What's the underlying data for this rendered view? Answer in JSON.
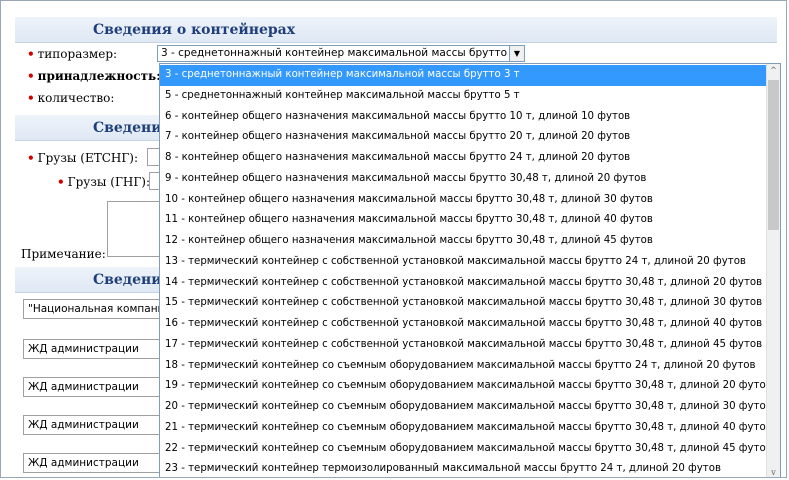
{
  "sections": {
    "containers_title": "Сведения о контейнерах",
    "cargo_title_partial": "Сведени",
    "other_title_partial": "Сведения"
  },
  "labels": {
    "size_type": "типоразмер:",
    "ownership": "принадлежность:",
    "quantity": "количество:",
    "cargo_etsng": "Грузы (ЕТСНГ):",
    "cargo_gng": "Грузы (ГНГ):",
    "note": "Примечание:",
    "required_mark": "•"
  },
  "size_type_select": {
    "value": "3 - среднетоннажный контейнер максимальной массы брутто 3 т",
    "arrow": "▼"
  },
  "left_inputs": [
    "\"Национальная компани",
    "ЖД администрации",
    "ЖД администрации",
    "ЖД администрации",
    "ЖД администрации"
  ],
  "dropdown_options": [
    "3 - среднетоннажный контейнер максимальной массы брутто 3 т",
    "5 - среднетоннажный контейнер максимальной массы брутто 5 т",
    "6 - контейнер общего назначения максимальной массы брутто 10 т, длиной 10 футов",
    "7 - контейнер общего назначения максимальной массы брутто 20 т, длиной 20 футов",
    "8 - контейнер общего назначения максимальной массы брутто 24 т, длиной 20 футов",
    "9 - контейнер общего назначения максимальной массы брутто 30,48 т, длиной 20 футов",
    "10 - контейнер общего назначения максимальной массы брутто 30,48 т, длиной 30 футов",
    "11 - контейнер общего назначения максимальной массы брутто 30,48 т, длиной 40 футов",
    "12 - контейнер общего назначения максимальной массы брутто 30,48 т, длиной 45 футов",
    "13 - термический контейнер с собственной установкой максимальной массы брутто 24 т, длиной 20 футов",
    "14 - термический контейнер с собственной установкой максимальной массы брутто 30,48 т, длиной 20 футов",
    "15 - термический контейнер с собственной установкой максимальной массы брутто 30,48 т, длиной 30 футов",
    "16 - термический контейнер с собственной установкой максимальной массы брутто 30,48 т, длиной 40 футов",
    "17 - термический контейнер с собственной установкой максимальной массы брутто 30,48 т, длиной 45 футов",
    "18 - термический контейнер со съемным оборудованием максимальной массы брутто 24 т, длиной 20 футов",
    "19 - термический контейнер со съемным оборудованием максимальной массы брутто 30,48 т, длиной 20 футов",
    "20 - термический контейнер со съемным оборудованием максимальной массы брутто 30,48 т, длиной 30 футов",
    "21 - термический контейнер со съемным оборудованием максимальной массы брутто 30,48 т, длиной 40 футов",
    "22 - термический контейнер со съемным оборудованием максимальной массы брутто 30,48 т, длиной 45 футов",
    "23 - термический контейнер термоизолированный максимальной массы брутто 24 т, длиной 20 футов"
  ],
  "selected_index": 0,
  "scrollbar": {
    "up": "^",
    "down": "v"
  },
  "colors": {
    "header_text": "#1f3f7a",
    "required": "#d10000",
    "selection": "#3399ff"
  }
}
